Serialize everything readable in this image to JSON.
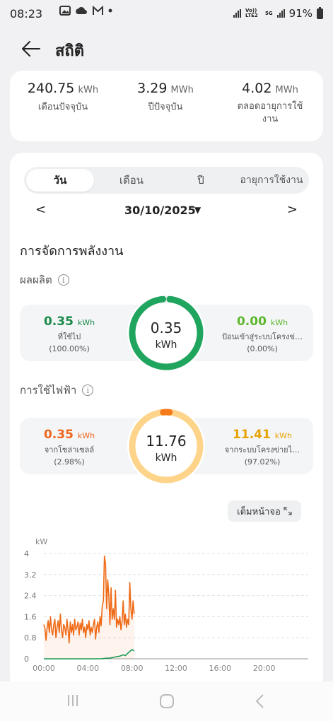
{
  "status": {
    "time": "08:23",
    "battery": "91%",
    "net1": "Vo)) LTE2",
    "net2": "5G"
  },
  "header": {
    "title": "สถิติ",
    "back_icon": "arrow-left-icon"
  },
  "summary": [
    {
      "value": "240.75",
      "unit": "kWh",
      "label": "เดือนปัจจุบัน"
    },
    {
      "value": "3.29",
      "unit": "MWh",
      "label": "ปีปัจจุบัน"
    },
    {
      "value": "4.02",
      "unit": "MWh",
      "label1": "ตลอดอายุการใช้",
      "label2": "งาน"
    }
  ],
  "tabs": [
    {
      "label": "วัน",
      "active": true
    },
    {
      "label": "เดือน",
      "active": false
    },
    {
      "label": "ปี",
      "active": false
    },
    {
      "label": "อายุการใช้งาน",
      "active": false
    }
  ],
  "date_nav": {
    "prev": "<",
    "date": "30/10/2025",
    "caret": "▼",
    "next": ">"
  },
  "energy_title": "การจัดการพลังงาน",
  "production": {
    "title": "ผลผลิต",
    "info": "i",
    "left": {
      "value": "0.35",
      "unit": "kWh",
      "label": "ที่ใช้ไป",
      "pct": "(100.00%)"
    },
    "center": {
      "value": "0.35",
      "unit": "kWh"
    },
    "right": {
      "value": "0.00",
      "unit": "kWh",
      "label": "ป้อนเข้าสู่ระบบโครงข่…",
      "pct": "(0.00%)"
    },
    "self_use_fraction": 1.0,
    "colors": {
      "left": "#1a8a4a",
      "right": "#5cb82c",
      "ring": "#1fa55e"
    }
  },
  "consumption": {
    "title": "การใช้ไฟฟ้า",
    "info": "i",
    "left": {
      "value": "0.35",
      "unit": "kWh",
      "label": "จากโซล่าเซลล์",
      "pct": "(2.98%)"
    },
    "center": {
      "value": "11.76",
      "unit": "kWh"
    },
    "right": {
      "value": "11.41",
      "unit": "kWh",
      "label": "จากระบบโครงข่ายไ…",
      "pct": "(97.02%)"
    },
    "solar_fraction": 0.0298,
    "colors": {
      "left": "#f0651e",
      "right": "#e8a300",
      "ring": "#fdd48a",
      "ring_solar": "#f57a1c"
    }
  },
  "fullscreen": {
    "label": "เต็มหน้าจอ",
    "icon": "expand-icon"
  },
  "chart_data": {
    "type": "line",
    "ylabel": "kW",
    "ylim": [
      0,
      4
    ],
    "yticks": [
      "0",
      "0.8",
      "1.6",
      "2.4",
      "3.2",
      "4"
    ],
    "xticks": [
      "00:00",
      "04:00",
      "08:00",
      "12:00",
      "16:00",
      "20:00"
    ],
    "xlim_hours": [
      0,
      24
    ],
    "series": [
      {
        "color": "#ef6a17",
        "x_hours": [
          0,
          0.1,
          0.2,
          0.3,
          0.4,
          0.5,
          0.6,
          0.7,
          0.8,
          0.9,
          1.0,
          1.1,
          1.2,
          1.3,
          1.4,
          1.5,
          1.6,
          1.7,
          1.8,
          1.9,
          2.0,
          2.1,
          2.2,
          2.3,
          2.4,
          2.5,
          2.6,
          2.7,
          2.8,
          2.9,
          3.0,
          3.1,
          3.2,
          3.3,
          3.4,
          3.5,
          3.6,
          3.7,
          3.8,
          3.9,
          4.0,
          4.1,
          4.2,
          4.3,
          4.4,
          4.5,
          4.6,
          4.7,
          4.8,
          4.9,
          5.0,
          5.1,
          5.2,
          5.3,
          5.4,
          5.5,
          5.6,
          5.7,
          5.8,
          5.9,
          6.0,
          6.1,
          6.2,
          6.3,
          6.4,
          6.5,
          6.6,
          6.7,
          6.8,
          6.9,
          7.0,
          7.1,
          7.2,
          7.3,
          7.4,
          7.5,
          7.6,
          7.7,
          7.8,
          7.9,
          8.0,
          8.1,
          8.2
        ],
        "values": [
          1.3,
          1.15,
          0.7,
          1.2,
          1.45,
          1.0,
          1.6,
          1.1,
          0.9,
          1.3,
          1.5,
          0.8,
          1.2,
          1.45,
          1.0,
          1.7,
          1.1,
          0.8,
          1.3,
          1.2,
          0.9,
          1.5,
          1.1,
          0.6,
          1.4,
          1.0,
          1.3,
          0.9,
          1.5,
          1.1,
          1.2,
          1.4,
          0.9,
          1.35,
          1.1,
          1.5,
          1.0,
          1.2,
          0.8,
          1.3,
          1.1,
          1.45,
          0.9,
          1.2,
          1.0,
          1.3,
          1.5,
          0.75,
          1.2,
          1.4,
          1.0,
          1.6,
          1.25,
          2.0,
          2.2,
          3.9,
          3.6,
          1.9,
          3.0,
          2.4,
          1.3,
          2.7,
          1.5,
          1.9,
          1.5,
          2.6,
          1.2,
          1.5,
          1.3,
          1.6,
          1.1,
          1.4,
          2.2,
          1.3,
          1.7,
          1.2,
          1.5,
          1.3,
          2.9,
          1.9,
          1.5,
          2.2,
          1.7
        ]
      },
      {
        "color": "#1a9a55",
        "x_hours": [
          0,
          5.2,
          5.6,
          6.0,
          6.3,
          6.6,
          6.9,
          7.2,
          7.4,
          7.6,
          7.8,
          8.0,
          8.2
        ],
        "values": [
          0,
          0,
          0.02,
          0.03,
          0.05,
          0.08,
          0.1,
          0.15,
          0.12,
          0.2,
          0.28,
          0.35,
          0.3
        ]
      }
    ]
  }
}
